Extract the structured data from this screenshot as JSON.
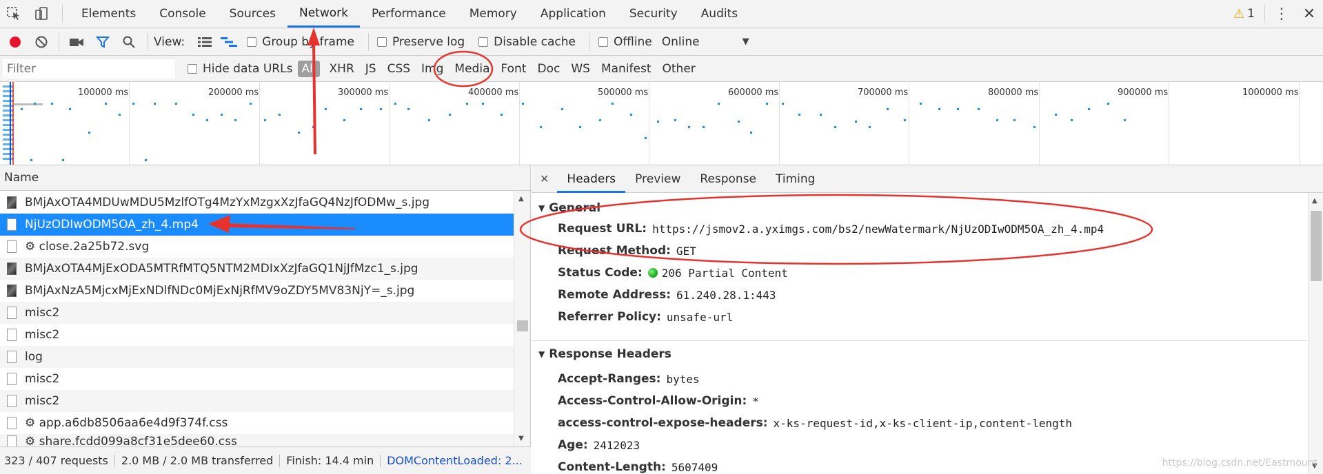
{
  "tabs": [
    "Elements",
    "Console",
    "Sources",
    "Network",
    "Performance",
    "Memory",
    "Application",
    "Security",
    "Audits"
  ],
  "active_tab": "Network",
  "warning_count": "1",
  "toolbar": {
    "view_label": "View:",
    "group_by_frame": "Group by frame",
    "preserve_log": "Preserve log",
    "disable_cache": "Disable cache",
    "offline": "Offline",
    "throttle": "Online"
  },
  "filter": {
    "placeholder": "Filter",
    "hide_data_urls": "Hide data URLs",
    "types": [
      "All",
      "XHR",
      "JS",
      "CSS",
      "Img",
      "Media",
      "Font",
      "Doc",
      "WS",
      "Manifest",
      "Other"
    ],
    "active_type": "All"
  },
  "timeline": {
    "labels": [
      "100000 ms",
      "200000 ms",
      "300000 ms",
      "400000 ms",
      "500000 ms",
      "600000 ms",
      "700000 ms",
      "800000 ms",
      "900000 ms",
      "1000000 ms"
    ]
  },
  "requests": {
    "header": "Name",
    "rows": [
      {
        "name": "BMjAxOTA4MDUwMDU5MzlfOTg4MzYxMzgxXzJfaGQ4NzJfODMw_s.jpg",
        "icon": "image"
      },
      {
        "name": "NjUzODIwODM5OA_zh_4.mp4",
        "icon": "file"
      },
      {
        "name": "⚙ close.2a25b72.svg",
        "icon": "file"
      },
      {
        "name": "BMjAxOTA4MjExODA5MTRfMTQ5NTM2MDIxXzJfaGQ1NjJfMzc1_s.jpg",
        "icon": "image"
      },
      {
        "name": "BMjAxNzA5MjcxMjExNDlfNDc0MjExNjRfMV9oZDY5MV83NjY=_s.jpg",
        "icon": "image"
      },
      {
        "name": "misc2",
        "icon": "file"
      },
      {
        "name": "misc2",
        "icon": "file"
      },
      {
        "name": "log",
        "icon": "file"
      },
      {
        "name": "misc2",
        "icon": "file"
      },
      {
        "name": "misc2",
        "icon": "file"
      },
      {
        "name": "⚙ app.a6db8506aa6e4d9f374f.css",
        "icon": "file"
      },
      {
        "name": "⚙ share.fcdd099a8cf31e5dee60.css",
        "icon": "file"
      }
    ],
    "selected_index": 1
  },
  "status": {
    "requests": "323 / 407 requests",
    "transferred": "2.0 MB / 2.0 MB transferred",
    "finish": "Finish: 14.4 min",
    "dcl": "DOMContentLoaded: 2..."
  },
  "details": {
    "tabs": [
      "Headers",
      "Preview",
      "Response",
      "Timing"
    ],
    "active_tab": "Headers",
    "general": {
      "title": "General",
      "request_url_label": "Request URL:",
      "request_url": "https://jsmov2.a.yximgs.com/bs2/newWatermark/NjUzODIwODM5OA_zh_4.mp4",
      "request_method_label": "Request Method:",
      "request_method": "GET",
      "status_code_label": "Status Code:",
      "status_code": "206 Partial Content",
      "status_color": "#1db01d",
      "remote_address_label": "Remote Address:",
      "remote_address": "61.240.28.1:443",
      "referrer_policy_label": "Referrer Policy:",
      "referrer_policy": "unsafe-url"
    },
    "response_headers": {
      "title": "Response Headers",
      "items": [
        {
          "k": "Accept-Ranges:",
          "v": "bytes"
        },
        {
          "k": "Access-Control-Allow-Origin:",
          "v": "*"
        },
        {
          "k": "access-control-expose-headers:",
          "v": "x-ks-request-id,x-ks-client-ip,content-length"
        },
        {
          "k": "Age:",
          "v": "2412023"
        },
        {
          "k": "Content-Length:",
          "v": "5607409"
        }
      ]
    }
  },
  "watermark": "https://blog.csdn.net/Eastmount",
  "colors": {
    "accent": "#1a73e8",
    "selection": "#1a8cff",
    "annotation": "#e8322e",
    "record": "#e8112d"
  }
}
